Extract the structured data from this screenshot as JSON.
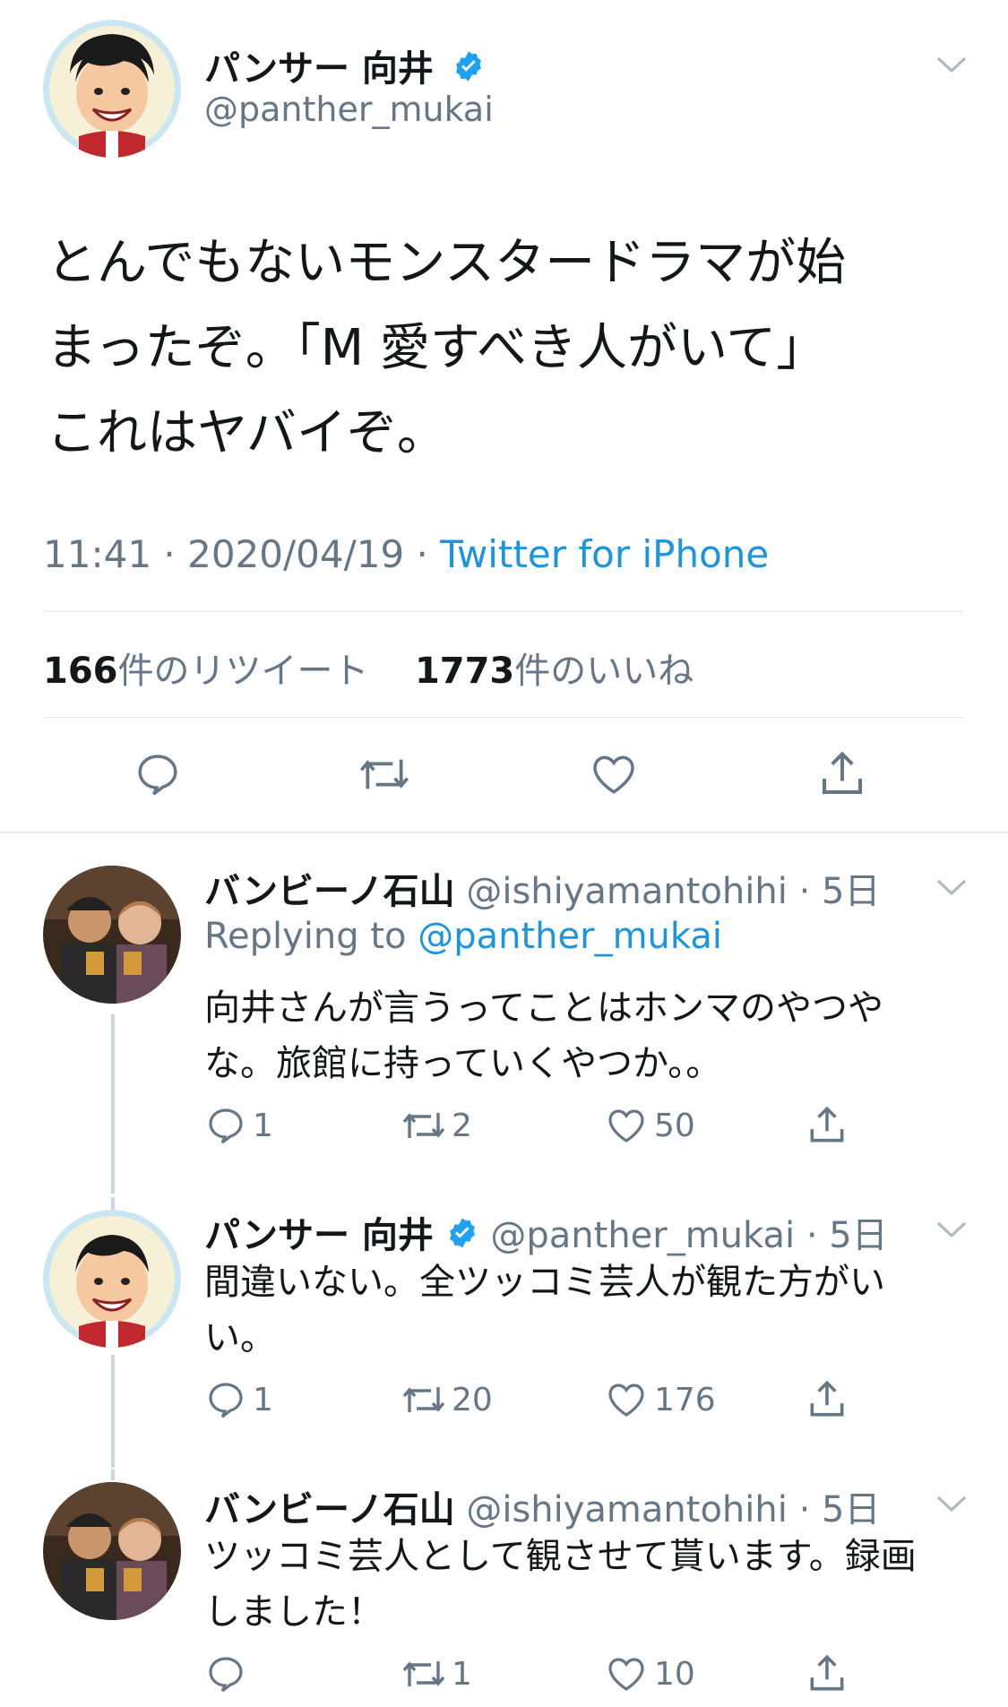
{
  "main_tweet": {
    "name": "パンサー 向井",
    "handle": "@panther_mukai",
    "text_lines": [
      "とんでもないモンスタードラマが始",
      "まったぞ。「M 愛すべき人がいて」",
      "これはヤバイぞ。"
    ],
    "time": "11:41",
    "date": "2020/04/19",
    "sep": " · ",
    "source": "Twitter for iPhone",
    "retweet_count": "166",
    "retweet_label": "件のリツイート",
    "like_count": "1773",
    "like_label": "件のいいね"
  },
  "replies": [
    {
      "name": "バンビーノ石山",
      "handle": "@ishiyamantohihi",
      "age": "· 5日",
      "replying_prefix": "Replying to ",
      "replying_to": "@panther_mukai",
      "text_lines": [
        "向井さんが言うってことはホンマのやつや",
        "な。旅館に持っていくやつか。。"
      ],
      "reply_count": "1",
      "retweet_count": "2",
      "like_count": "50"
    },
    {
      "name": "パンサー 向井",
      "handle": "@panther_mukai",
      "age": "· 5日",
      "text_lines": [
        "間違いない。全ツッコミ芸人が観た方がい",
        "い。"
      ],
      "reply_count": "1",
      "retweet_count": "20",
      "like_count": "176"
    },
    {
      "name": "バンビーノ石山",
      "handle": "@ishiyamantohihi",
      "age": "· 5日",
      "text_lines": [
        "ツッコミ芸人として観させて貰います。録画",
        "しました！"
      ],
      "reply_count": "",
      "retweet_count": "1",
      "like_count": "10"
    }
  ],
  "icons": {
    "reply": "reply-icon",
    "retweet": "retweet-icon",
    "like": "heart-icon",
    "share": "share-icon",
    "verified": "verified-badge-icon",
    "more": "chevron-down-icon"
  },
  "colors": {
    "link_blue": "#1b95e0",
    "verified_blue": "#1da1f2",
    "secondary_gray": "#657786"
  }
}
